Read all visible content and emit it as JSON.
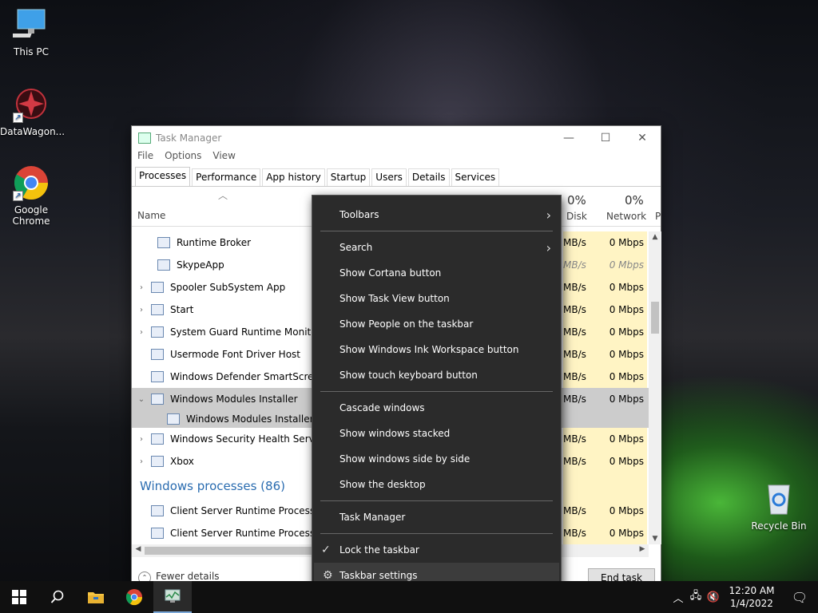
{
  "desktop": {
    "icons": [
      {
        "label": "This PC"
      },
      {
        "label": "DataWagon..."
      },
      {
        "label": "Google\nChrome"
      },
      {
        "label": "Recycle Bin"
      }
    ]
  },
  "task_manager": {
    "title": "Task Manager",
    "menu": [
      "File",
      "Options",
      "View"
    ],
    "tabs": [
      "Processes",
      "Performance",
      "App history",
      "Startup",
      "Users",
      "Details",
      "Services"
    ],
    "active_tab": "Processes",
    "columns": {
      "name": "Name",
      "disk_pct": "0%",
      "disk": "Disk",
      "network_pct": "0%",
      "network": "Network",
      "p": "P"
    },
    "rows": [
      {
        "name": "Runtime Broker",
        "disk": "MB/s",
        "net": "0 Mbps",
        "child": true
      },
      {
        "name": "SkypeApp",
        "disk": "MB/s",
        "net": "0 Mbps",
        "child": true,
        "italic": true
      },
      {
        "name": "Spooler SubSystem App",
        "disk": "MB/s",
        "net": "0 Mbps",
        "expand": "›"
      },
      {
        "name": "Start",
        "disk": "MB/s",
        "net": "0 Mbps",
        "expand": "›"
      },
      {
        "name": "System Guard Runtime Monitor...",
        "disk": "MB/s",
        "net": "0 Mbps",
        "expand": "›"
      },
      {
        "name": "Usermode Font Driver Host",
        "disk": "MB/s",
        "net": "0 Mbps"
      },
      {
        "name": "Windows Defender SmartScreen",
        "disk": "MB/s",
        "net": "0 Mbps"
      },
      {
        "name": "Windows Modules Installer",
        "disk": "MB/s",
        "net": "0 Mbps",
        "expand": "⌄",
        "selected": true
      },
      {
        "name": "Windows Modules Installer",
        "disk": "",
        "net": "",
        "child": true,
        "selected": true,
        "sub": true
      },
      {
        "name": "Windows Security Health Service",
        "disk": "MB/s",
        "net": "0 Mbps",
        "expand": "›"
      },
      {
        "name": "Xbox",
        "disk": "MB/s",
        "net": "0 Mbps",
        "expand": "›"
      }
    ],
    "group_label": "Windows processes (86)",
    "rows2": [
      {
        "name": "Client Server Runtime Process",
        "disk": "MB/s",
        "net": "0 Mbps"
      },
      {
        "name": "Client Server Runtime Process",
        "disk": "MB/s",
        "net": "0 Mbps"
      }
    ],
    "fewer_details": "Fewer details",
    "end_task": "End task"
  },
  "context_menu": {
    "items": [
      {
        "label": "Toolbars",
        "submenu": true
      },
      {
        "sep": true
      },
      {
        "label": "Search",
        "submenu": true
      },
      {
        "label": "Show Cortana button"
      },
      {
        "label": "Show Task View button"
      },
      {
        "label": "Show People on the taskbar"
      },
      {
        "label": "Show Windows Ink Workspace button"
      },
      {
        "label": "Show touch keyboard button"
      },
      {
        "sep": true
      },
      {
        "label": "Cascade windows"
      },
      {
        "label": "Show windows stacked"
      },
      {
        "label": "Show windows side by side"
      },
      {
        "label": "Show the desktop"
      },
      {
        "sep": true
      },
      {
        "label": "Task Manager"
      },
      {
        "sep": true
      },
      {
        "label": "Lock the taskbar",
        "icon": "checkmark-icon"
      },
      {
        "label": "Taskbar settings",
        "icon": "gear-icon",
        "hover": true
      }
    ]
  },
  "taskbar": {
    "clock_time": "12:20 AM",
    "clock_date": "1/4/2022",
    "accent": "#7aa7d8"
  }
}
